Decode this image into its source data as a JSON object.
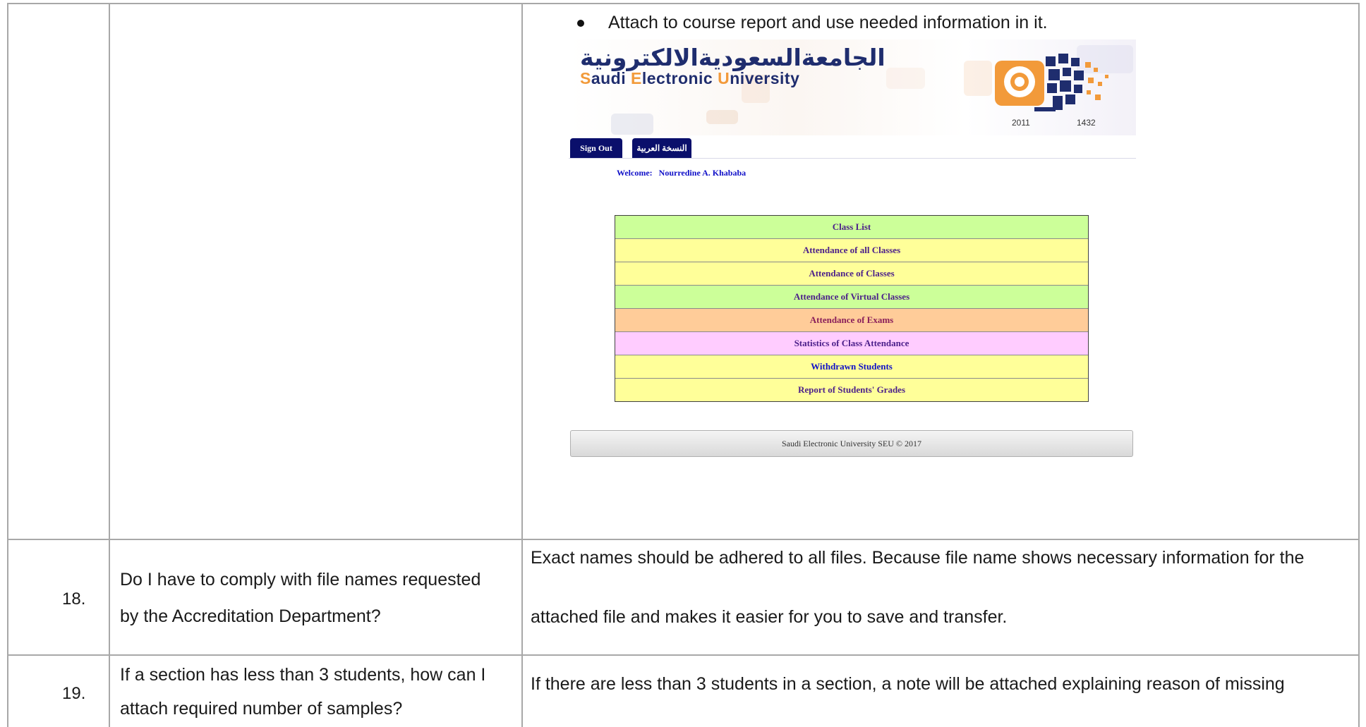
{
  "top_row": {
    "bullet_text": "Attach to course report and use needed information in it."
  },
  "portal": {
    "logo_arabic": "الجامعةالسعوديةالالكترونية",
    "logo_english_parts": [
      "S",
      "audi ",
      "E",
      "lectronic ",
      "U",
      "niversity"
    ],
    "year_left": "2011",
    "year_right": "1432",
    "tabs": [
      "Sign Out",
      "النسخة العربية"
    ],
    "welcome_label": "Welcome:",
    "welcome_name": "Nourredine A. Khababa",
    "menu": [
      {
        "label": "Class List",
        "color": "#ccff99"
      },
      {
        "label": "Attendance of all Classes",
        "color": "#ffff99"
      },
      {
        "label": "Attendance of Classes",
        "color": "#ffff99"
      },
      {
        "label": "Attendance of Virtual Classes",
        "color": "#ccff99"
      },
      {
        "label": "Attendance of Exams",
        "color": "#ffcc99"
      },
      {
        "label": "Statistics of Class Attendance",
        "color": "#ffccff"
      },
      {
        "label": "Withdrawn Students",
        "color": "#ffff99"
      },
      {
        "label": "Report of Students' Grades",
        "color": "#ffff99"
      }
    ],
    "footer": "Saudi Electronic University SEU © 2017",
    "brand_navy": "#0a0f6b",
    "brand_orange": "#f29a3a"
  },
  "rows": [
    {
      "number": "18.",
      "question_lines": [
        "Do I have to comply with file names requested",
        "by the Accreditation Department?"
      ],
      "answer_lines": [
        "Exact names should be adhered to all files. Because file name shows necessary information for the",
        "attached file and makes it easier for you to save and transfer."
      ]
    },
    {
      "number": "19.",
      "question_lines": [
        "If a section has less than 3 students, how can I",
        "attach required number of samples?"
      ],
      "answer_lines": [
        "If there are less than 3 students in a section, a note will be attached explaining reason of missing"
      ]
    }
  ]
}
